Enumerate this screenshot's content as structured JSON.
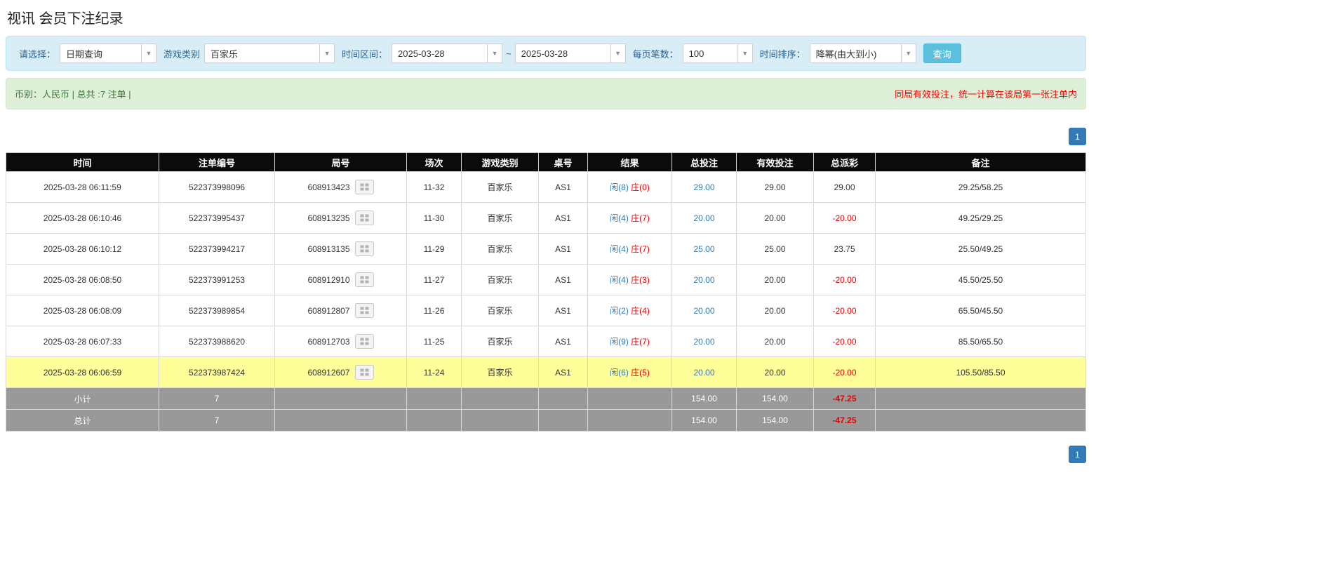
{
  "page": {
    "title": "视讯 会员下注纪录"
  },
  "filters": {
    "select_label": "请选择：",
    "select_value": "日期查询",
    "game_type_label": "游戏类别",
    "game_type_value": "百家乐",
    "time_range_label": "时间区间：",
    "date_from": "2025-03-28",
    "date_separator": "~",
    "date_to": "2025-03-28",
    "page_size_label": "每页笔数：",
    "page_size_value": "100",
    "sort_label": "时间排序：",
    "sort_value": "降幂(由大到小)",
    "search_button": "查询"
  },
  "summary": {
    "left": "币别：人民币 | 总共 :7 注单 |",
    "right_notice": "同局有效投注，统一计算在该局第一张注单内"
  },
  "pagination": {
    "page": "1"
  },
  "table": {
    "headers": [
      "时间",
      "注单编号",
      "局号",
      "场次",
      "游戏类别",
      "桌号",
      "结果",
      "总投注",
      "有效投注",
      "总派彩",
      "备注"
    ],
    "rows": [
      {
        "time": "2025-03-28 06:11:59",
        "bet_id": "522373998096",
        "round_id": "608913423",
        "session": "11-32",
        "game": "百家乐",
        "table_no": "AS1",
        "result_player": "闲(8)",
        "result_banker": "庄(0)",
        "total_bet": "29.00",
        "valid_bet": "29.00",
        "payout": "29.00",
        "payout_negative": false,
        "remark": "29.25/58.25",
        "highlight": false
      },
      {
        "time": "2025-03-28 06:10:46",
        "bet_id": "522373995437",
        "round_id": "608913235",
        "session": "11-30",
        "game": "百家乐",
        "table_no": "AS1",
        "result_player": "闲(4)",
        "result_banker": "庄(7)",
        "total_bet": "20.00",
        "valid_bet": "20.00",
        "payout": "-20.00",
        "payout_negative": true,
        "remark": "49.25/29.25",
        "highlight": false
      },
      {
        "time": "2025-03-28 06:10:12",
        "bet_id": "522373994217",
        "round_id": "608913135",
        "session": "11-29",
        "game": "百家乐",
        "table_no": "AS1",
        "result_player": "闲(4)",
        "result_banker": "庄(7)",
        "total_bet": "25.00",
        "valid_bet": "25.00",
        "payout": "23.75",
        "payout_negative": false,
        "remark": "25.50/49.25",
        "highlight": false
      },
      {
        "time": "2025-03-28 06:08:50",
        "bet_id": "522373991253",
        "round_id": "608912910",
        "session": "11-27",
        "game": "百家乐",
        "table_no": "AS1",
        "result_player": "闲(4)",
        "result_banker": "庄(3)",
        "total_bet": "20.00",
        "valid_bet": "20.00",
        "payout": "-20.00",
        "payout_negative": true,
        "remark": "45.50/25.50",
        "highlight": false
      },
      {
        "time": "2025-03-28 06:08:09",
        "bet_id": "522373989854",
        "round_id": "608912807",
        "session": "11-26",
        "game": "百家乐",
        "table_no": "AS1",
        "result_player": "闲(2)",
        "result_banker": "庄(4)",
        "total_bet": "20.00",
        "valid_bet": "20.00",
        "payout": "-20.00",
        "payout_negative": true,
        "remark": "65.50/45.50",
        "highlight": false
      },
      {
        "time": "2025-03-28 06:07:33",
        "bet_id": "522373988620",
        "round_id": "608912703",
        "session": "11-25",
        "game": "百家乐",
        "table_no": "AS1",
        "result_player": "闲(9)",
        "result_banker": "庄(7)",
        "total_bet": "20.00",
        "valid_bet": "20.00",
        "payout": "-20.00",
        "payout_negative": true,
        "remark": "85.50/65.50",
        "highlight": false
      },
      {
        "time": "2025-03-28 06:06:59",
        "bet_id": "522373987424",
        "round_id": "608912607",
        "session": "11-24",
        "game": "百家乐",
        "table_no": "AS1",
        "result_player": "闲(6)",
        "result_banker": "庄(5)",
        "total_bet": "20.00",
        "valid_bet": "20.00",
        "payout": "-20.00",
        "payout_negative": true,
        "remark": "105.50/85.50",
        "highlight": true
      }
    ],
    "subtotal": {
      "label": "小计",
      "count": "7",
      "total_bet": "154.00",
      "valid_bet": "154.00",
      "payout": "-47.25"
    },
    "total": {
      "label": "总计",
      "count": "7",
      "total_bet": "154.00",
      "valid_bet": "154.00",
      "payout": "-47.25"
    }
  },
  "colors": {
    "accent_blue": "#337ab7",
    "negative_red": "#e60000",
    "highlight_yellow": "#ffff99",
    "filter_bg": "#d9edf7",
    "summary_bg": "#dff0d8",
    "footer_gray": "#999999"
  }
}
